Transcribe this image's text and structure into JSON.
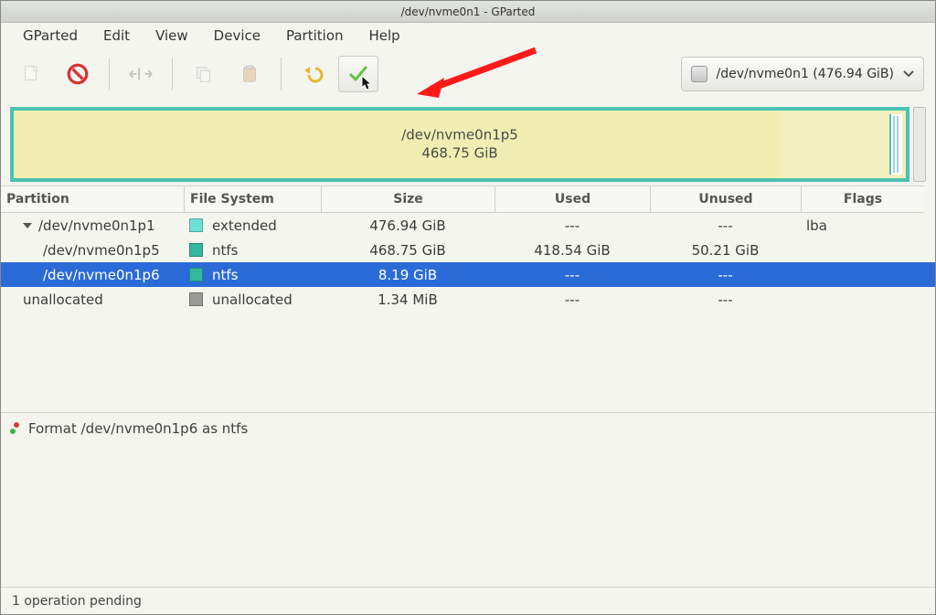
{
  "title": "/dev/nvme0n1 - GParted",
  "menu": {
    "gparted": "GParted",
    "edit": "Edit",
    "view": "View",
    "device": "Device",
    "partition": "Partition",
    "help": "Help"
  },
  "device_selector": "/dev/nvme0n1 (476.94 GiB)",
  "map": {
    "name": "/dev/nvme0n1p5",
    "size": "468.75 GiB"
  },
  "columns": {
    "partition": "Partition",
    "fs": "File System",
    "size": "Size",
    "used": "Used",
    "unused": "Unused",
    "flags": "Flags"
  },
  "rows": [
    {
      "part": "/dev/nvme0n1p1",
      "fs": "extended",
      "swatch": "#6fe0d5",
      "size": "476.94 GiB",
      "used": "---",
      "unused": "---",
      "flags": "lba",
      "indent": 1,
      "expander": true
    },
    {
      "part": "/dev/nvme0n1p5",
      "fs": "ntfs",
      "swatch": "#34b89f",
      "size": "468.75 GiB",
      "used": "418.54 GiB",
      "unused": "50.21 GiB",
      "flags": "",
      "indent": 2
    },
    {
      "part": "/dev/nvme0n1p6",
      "fs": "ntfs",
      "swatch": "#34b89f",
      "size": "8.19 GiB",
      "used": "---",
      "unused": "---",
      "flags": "",
      "indent": 2,
      "selected": true
    },
    {
      "part": "unallocated",
      "fs": "unallocated",
      "swatch": "#9a9a96",
      "size": "1.34 MiB",
      "used": "---",
      "unused": "---",
      "flags": "",
      "indent": 1
    }
  ],
  "operation": "Format /dev/nvme0n1p6 as ntfs",
  "status": "1 operation pending"
}
